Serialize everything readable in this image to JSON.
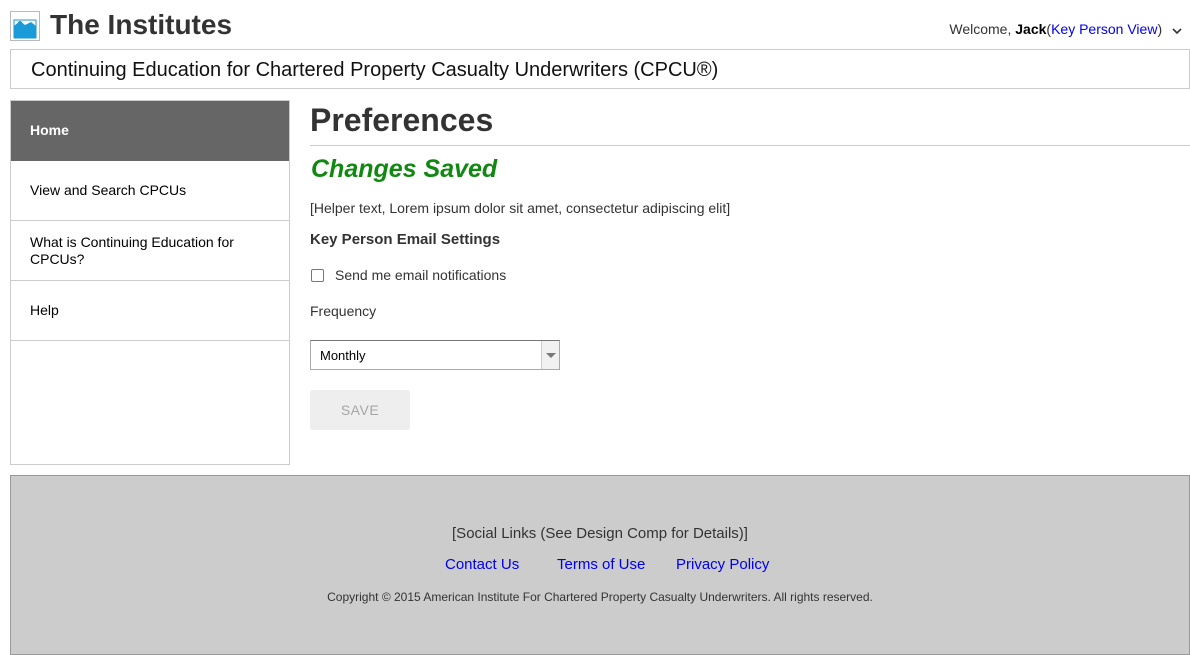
{
  "header": {
    "site_title": "The Institutes",
    "welcome_prefix": "Welcome,",
    "user_name": "Jack",
    "role_open": "(",
    "role_link": "Key Person View",
    "role_close": ")",
    "logo_icon": "image-placeholder-icon",
    "chevron_icon": "chevron-down-icon"
  },
  "program": {
    "title": "Continuing Education for Chartered Property Casualty Underwriters (CPCU®)"
  },
  "sidebar": {
    "items": [
      {
        "label": "Home",
        "active": true
      },
      {
        "label": "View and Search CPCUs",
        "active": false
      },
      {
        "label": "What is Continuing Education for CPCUs?",
        "active": false
      },
      {
        "label": "Help",
        "active": false
      }
    ]
  },
  "main": {
    "title": "Preferences",
    "status_message": "Changes Saved",
    "status_color": "#118811",
    "helper_text": "[Helper text, Lorem ipsum dolor sit amet, consectetur adipiscing elit]",
    "section_heading": "Key Person Email Settings",
    "checkbox_label": "Send me email notifications",
    "checkbox_checked": false,
    "frequency_label": "Frequency",
    "frequency_value": "Monthly",
    "save_label": "SAVE"
  },
  "footer": {
    "social_placeholder": "[Social Links (See Design Comp for Details)]",
    "links": [
      "Contact Us",
      "Terms of Use",
      "Privacy Policy"
    ],
    "copyright": "Copyright © 2015 American Institute For Chartered Property Casualty Underwriters. All rights reserved."
  }
}
